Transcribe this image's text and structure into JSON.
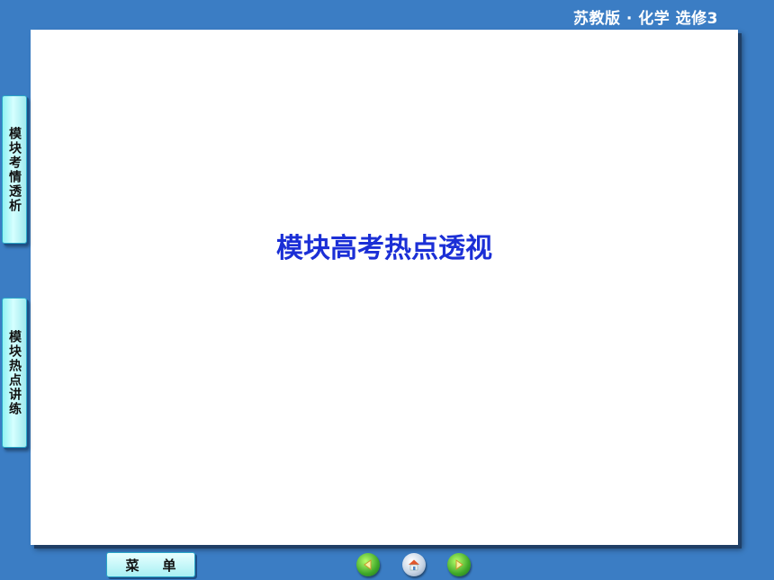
{
  "header": {
    "title": "苏教版 · 化学  选修3"
  },
  "slide": {
    "title": "模块高考热点透视"
  },
  "side_tabs": [
    {
      "label": "模块考情透析"
    },
    {
      "label": "模块热点讲练"
    }
  ],
  "footer": {
    "menu_label": "菜单",
    "icons": [
      "previous-icon",
      "home-icon",
      "next-icon"
    ]
  },
  "colors": {
    "background": "#3b7dc4",
    "title_text": "#1b2fd6",
    "tab_fill": "#c8fbfb"
  }
}
